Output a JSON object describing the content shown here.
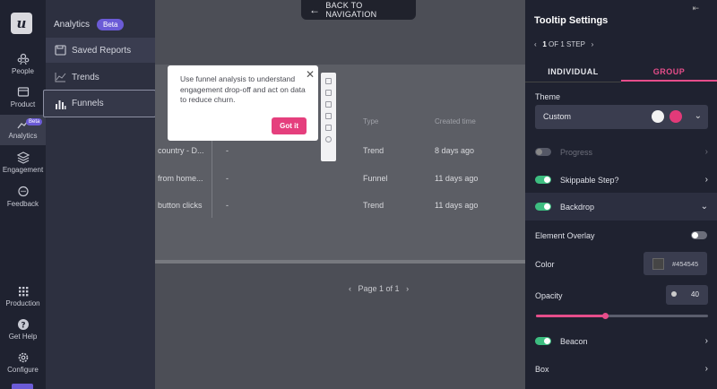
{
  "nav": {
    "logo": "u",
    "items": [
      {
        "label": "People",
        "icon": "people-icon"
      },
      {
        "label": "Product",
        "icon": "product-icon"
      },
      {
        "label": "Analytics",
        "icon": "analytics-icon",
        "badge": "Beta"
      },
      {
        "label": "Engagement",
        "icon": "engagement-icon"
      },
      {
        "label": "Feedback",
        "icon": "feedback-icon"
      }
    ],
    "bottom": [
      {
        "label": "Production",
        "icon": "grid-icon"
      },
      {
        "label": "Get Help",
        "icon": "help-icon"
      },
      {
        "label": "Configure",
        "icon": "gear-icon"
      }
    ]
  },
  "submenu": {
    "title": "Analytics",
    "badge": "Beta",
    "items": [
      {
        "label": "Saved Reports",
        "icon": "save-icon"
      },
      {
        "label": "Trends",
        "icon": "trends-icon"
      },
      {
        "label": "Funnels",
        "icon": "funnel-bars-icon"
      }
    ]
  },
  "back_button": "BACK TO NAVIGATION",
  "table": {
    "headers": [
      "Type",
      "Created time"
    ],
    "rows": [
      {
        "name": "country - D...",
        "desc": "-",
        "type": "Trend",
        "created": "8 days ago"
      },
      {
        "name": "from home...",
        "desc": "-",
        "type": "Funnel",
        "created": "11 days ago"
      },
      {
        "name": "button clicks",
        "desc": "-",
        "type": "Trend",
        "created": "11 days ago"
      }
    ],
    "pager": "Page 1 of 1"
  },
  "tooltip": {
    "text": "Use funnel analysis to understand engagement drop-off and act on data to reduce churn.",
    "button": "Got it"
  },
  "panel": {
    "title": "Tooltip Settings",
    "step_current": "1",
    "step_total": "OF 1 STEP",
    "tabs": [
      "INDIVIDUAL",
      "GROUP"
    ],
    "active_tab": "GROUP",
    "theme_label": "Theme",
    "theme_value": "Custom",
    "rows": {
      "progress": "Progress",
      "skippable": "Skippable Step?",
      "backdrop": "Backdrop",
      "element_overlay": "Element Overlay",
      "color": "Color",
      "color_value": "#454545",
      "opacity": "Opacity",
      "opacity_value": "40",
      "beacon": "Beacon",
      "box": "Box"
    },
    "opacity_fraction": 0.4,
    "accent": "#e64d8a",
    "toggle_on_color": "#3dbd80"
  }
}
